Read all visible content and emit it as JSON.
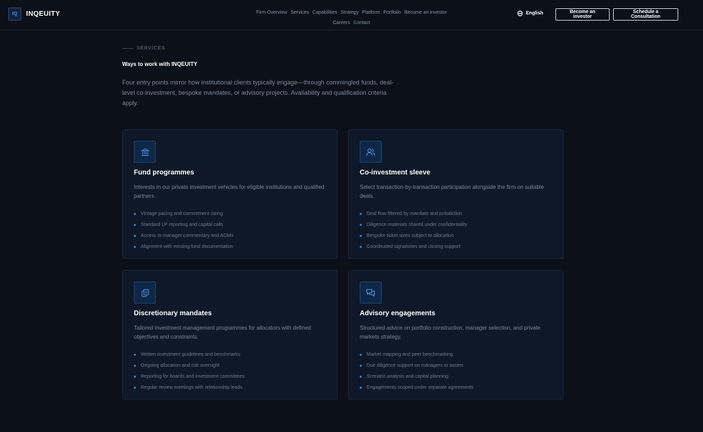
{
  "brand": {
    "mark": "IQ",
    "name": "INQEUITY"
  },
  "nav": {
    "items": [
      "Firm Overview",
      "Services",
      "Capabilities",
      "Strategy",
      "Platform",
      "Portfolio",
      "Become an investor",
      "Careers",
      "Contact"
    ]
  },
  "header": {
    "language": "English",
    "investor_button": "Become an investor",
    "consult_button": "Schedule a Consultation"
  },
  "section": {
    "eyebrow": "SERVICES",
    "title": "Ways to work with INQEUITY",
    "intro": "Four entry points mirror how institutional clients typically engage—through commingled funds, deal-level co-investment, bespoke mandates, or advisory projects. Availability and qualification criteria apply."
  },
  "cards": [
    {
      "icon": "bank-icon",
      "title": "Fund programmes",
      "description": "Interests in our private investment vehicles for eligible institutions and qualified partners.",
      "items": [
        "Vintage pacing and commitment sizing",
        "Standard LP reporting and capital calls",
        "Access to manager commentary and AGMs",
        "Alignment with existing fund documentation"
      ]
    },
    {
      "icon": "users-icon",
      "title": "Co-investment sleeve",
      "description": "Select transaction-by-transaction participation alongside the firm on suitable deals.",
      "items": [
        "Deal flow filtered by mandate and jurisdiction",
        "Diligence materials shared under confidentiality",
        "Bespoke ticket sizes subject to allocation",
        "Coordinated signatories and closing support"
      ]
    },
    {
      "icon": "documents-icon",
      "title": "Discretionary mandates",
      "description": "Tailored investment management programmes for allocators with defined objectives and constraints.",
      "items": [
        "Written investment guidelines and benchmarks",
        "Ongoing allocation and risk oversight",
        "Reporting for boards and investment committees",
        "Regular review meetings with relationship leads"
      ]
    },
    {
      "icon": "chat-icon",
      "title": "Advisory engagements",
      "description": "Structured advice on portfolio construction, manager selection, and private markets strategy.",
      "items": [
        "Market mapping and peer benchmarking",
        "Due diligence support on managers or assets",
        "Scenario analysis and capital planning",
        "Engagements scoped under separate agreements"
      ]
    }
  ],
  "colors": {
    "background": "#0b1019",
    "card": "#0e1828",
    "accent": "#3d7fd6"
  }
}
